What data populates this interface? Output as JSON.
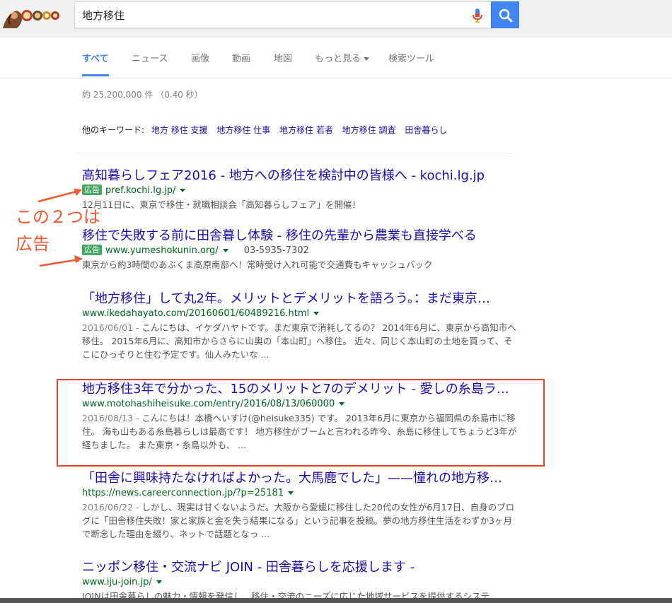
{
  "search": {
    "query": "地方移住"
  },
  "tabs": [
    {
      "label": "すべて"
    },
    {
      "label": "ニュース"
    },
    {
      "label": "画像"
    },
    {
      "label": "動画"
    },
    {
      "label": "地図"
    },
    {
      "label": "もっと見る"
    },
    {
      "label": "検索ツール"
    }
  ],
  "stats": "約 25,200,000 件 （0.40 秒）",
  "related": {
    "label": "他のキーワード:",
    "items": [
      "地方 移住 支援",
      "地方移住 仕事",
      "地方移住 若者",
      "地方移住 調査",
      "田舎暮らし"
    ]
  },
  "results": [
    {
      "title": "高知暮らしフェア2016 - 地方への移住を検討中の皆様へ - kochi.lg.jp",
      "ad_label": "広告",
      "url": "pref.kochi.lg.jp/",
      "snippet": "12月11日に、東京で移住・就職相談会「高知暮らしフェア」を開催！"
    },
    {
      "title": "移住で失敗する前に田舎暮し体験 - 移住の先輩から農業も直接学べる",
      "ad_label": "広告",
      "url": "www.yumeshokunin.org/",
      "phone": "03-5935-7302",
      "snippet": "東京から約3時間のあぶくま高原南部へ！常時受け入れ可能で交通費もキャッシュバック"
    },
    {
      "title": "「地方移住」して丸2年。メリットとデメリットを語ろう。：まだ東京…",
      "url": "www.ikedahayato.com/20160601/60489216.html",
      "date": "2016/06/01 - ",
      "snippet": "こんにちは、イケダハヤトです。まだ東京で消耗してるの？ 2014年6月に、東京から高知市へ移住。 2015年6月に、高知市からさらに山奥の「本山町」へ移住。 近々、同じく本山町の土地を買って、そこにひっそりと住む予定です。仙人みたいな ..."
    },
    {
      "title": "地方移住3年で分かった、15のメリットと7のデメリット - 愛しの糸島ラ…",
      "url": "www.motohashiheisuke.com/entry/2016/08/13/060000",
      "date": "2016/08/13 - ",
      "snippet": "こんにちは！本橋へいすけ(@heisuke335) です。 2013年6月に東京から福岡県の糸島市に移住。 海も山もある糸島暮らしは最高です！ 地方移住がブームと言われる昨今、糸島に移住してちょうど3年が経ちました。 また東京・糸島以外も、 ..."
    },
    {
      "title": "「田舎に興味持たなければよかった。大馬鹿でした」——憧れの地方移…",
      "url": "https://news.careerconnection.jp/?p=25181",
      "date": "2016/06/22 - ",
      "snippet": "しかし、現実は甘くないようだ。大阪から愛媛に移住した20代の女性が6月17日、自身のブログに「田舎移住失敗！家と家族と金を失う結果になる」という記事を投稿。夢の地方移住生活をわずか3ヶ月で断念した理由を綴り、ネットで話題となっ ..."
    },
    {
      "title": "ニッポン移住・交流ナビ JOIN - 田舎暮らしを応援します -",
      "url": "www.iju-join.jp/",
      "snippet": "JOINは田舎暮らしの魅力・情報を発信し、移住・交流のニーズに応じた地域サービスを提供するシステ"
    }
  ],
  "annotation": {
    "line1": "この２つは",
    "line2": "広告"
  },
  "colors": {
    "accent": "#4285f4",
    "link": "#1a0dab",
    "url_green": "#006621",
    "ad_badge": "#45a862",
    "annotation": "#f0582f"
  }
}
